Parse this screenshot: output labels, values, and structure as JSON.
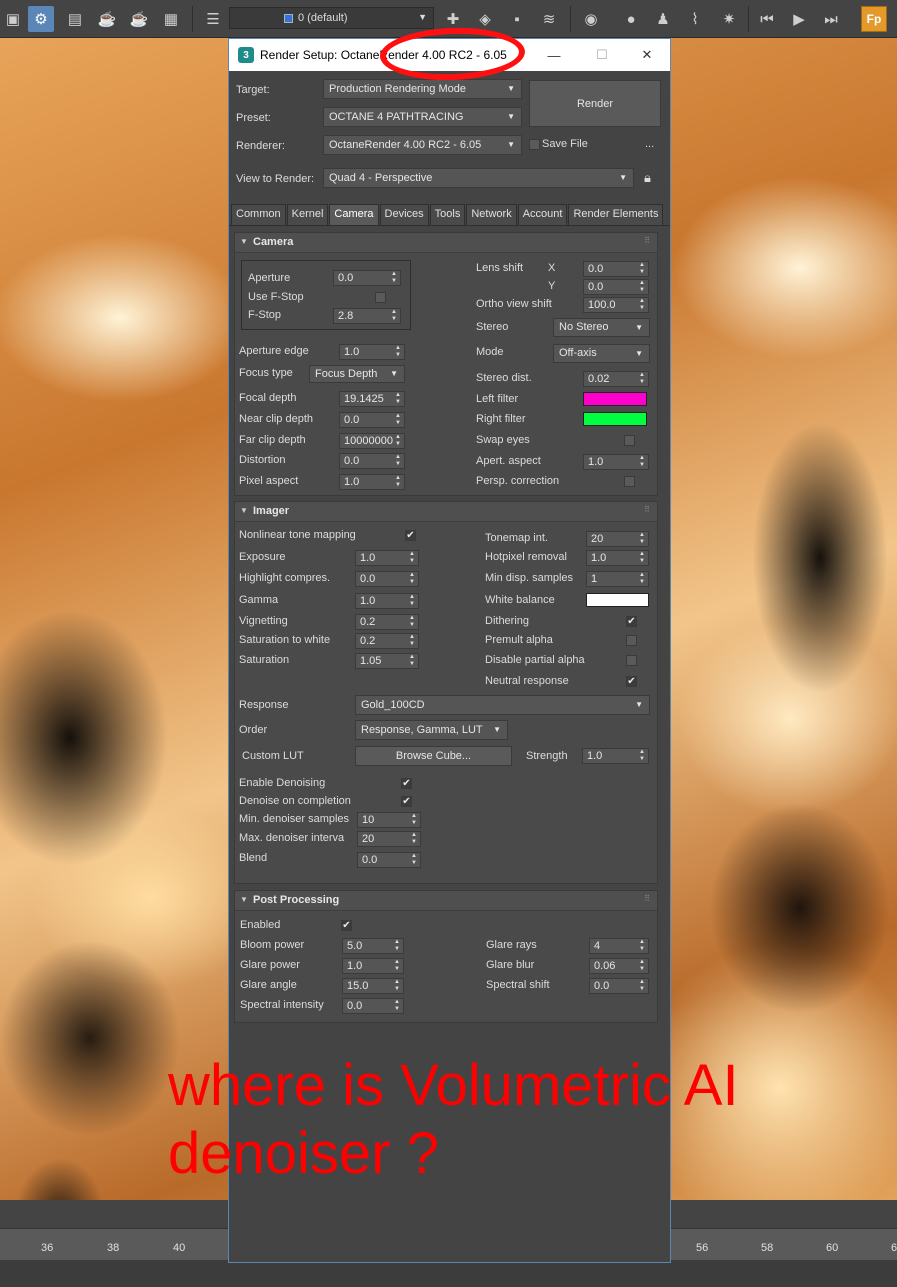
{
  "toolbar": {
    "layer_dropdown": "0 (default)",
    "fp_label": "Fp"
  },
  "dialog": {
    "title": "Render Setup: OctaneRender 4.00 RC2 - 6.05",
    "app_icon": "3",
    "target_label": "Target:",
    "target_value": "Production Rendering Mode",
    "preset_label": "Preset:",
    "preset_value": "OCTANE 4 PATHTRACING",
    "renderer_label": "Renderer:",
    "renderer_value": "OctaneRender 4.00 RC2 - 6.05",
    "render_button": "Render",
    "save_file_label": "Save File",
    "more_label": "...",
    "view_label": "View to Render:",
    "view_value": "Quad 4 - Perspective",
    "tabs": [
      "Common",
      "Kernel",
      "Camera",
      "Devices",
      "Tools",
      "Network",
      "Account",
      "Render Elements"
    ],
    "active_tab": "Camera"
  },
  "camera": {
    "title": "Camera",
    "aperture_label": "Aperture",
    "aperture": "0.0",
    "use_fstop_label": "Use F-Stop",
    "fstop_label": "F-Stop",
    "fstop": "2.8",
    "aperture_edge_label": "Aperture edge",
    "aperture_edge": "1.0",
    "focus_type_label": "Focus type",
    "focus_type": "Focus Depth",
    "focal_depth_label": "Focal depth",
    "focal_depth": "19.1425",
    "near_clip_label": "Near clip depth",
    "near_clip": "0.0",
    "far_clip_label": "Far clip depth",
    "far_clip": "10000000",
    "distortion_label": "Distortion",
    "distortion": "0.0",
    "pixel_aspect_label": "Pixel aspect",
    "pixel_aspect": "1.0",
    "lens_shift_label": "Lens shift",
    "x_label": "X",
    "y_label": "Y",
    "lens_shift_x": "0.0",
    "lens_shift_y": "0.0",
    "ortho_label": "Ortho view shift",
    "ortho": "100.0",
    "stereo_label": "Stereo",
    "stereo": "No Stereo",
    "mode_label": "Mode",
    "mode": "Off-axis",
    "stereo_dist_label": "Stereo dist.",
    "stereo_dist": "0.02",
    "left_filter_label": "Left filter",
    "left_filter_color": "#ff00cc",
    "right_filter_label": "Right filter",
    "right_filter_color": "#00ff40",
    "swap_eyes_label": "Swap eyes",
    "apert_aspect_label": "Apert. aspect",
    "apert_aspect": "1.0",
    "persp_corr_label": "Persp. correction"
  },
  "imager": {
    "title": "Imager",
    "nonlinear_label": "Nonlinear tone mapping",
    "exposure_label": "Exposure",
    "exposure": "1.0",
    "highlight_label": "Highlight compres.",
    "highlight": "0.0",
    "gamma_label": "Gamma",
    "gamma": "1.0",
    "vignetting_label": "Vignetting",
    "vignetting": "0.2",
    "sat_white_label": "Saturation to white",
    "sat_white": "0.2",
    "saturation_label": "Saturation",
    "saturation": "1.05",
    "tonemap_label": "Tonemap int.",
    "tonemap": "20",
    "hotpixel_label": "Hotpixel removal",
    "hotpixel": "1.0",
    "min_disp_label": "Min disp. samples",
    "min_disp": "1",
    "white_balance_label": "White balance",
    "white_balance_color": "#ffffff",
    "dithering_label": "Dithering",
    "premult_label": "Premult alpha",
    "disable_partial_label": "Disable partial alpha",
    "neutral_label": "Neutral response",
    "response_label": "Response",
    "response": "Gold_100CD",
    "order_label": "Order",
    "order": "Response, Gamma, LUT",
    "custom_lut_label": "Custom LUT",
    "browse_cube": "Browse Cube...",
    "strength_label": "Strength",
    "strength": "1.0",
    "enable_denoise_label": "Enable Denoising",
    "denoise_completion_label": "Denoise on completion",
    "min_denoiser_label": "Min. denoiser samples",
    "min_denoiser": "10",
    "max_denoiser_label": "Max. denoiser interva",
    "max_denoiser": "20",
    "blend_label": "Blend",
    "blend": "0.0",
    "check_mark": "✔"
  },
  "post": {
    "title": "Post Processing",
    "enabled_label": "Enabled",
    "bloom_label": "Bloom power",
    "bloom": "5.0",
    "glare_power_label": "Glare power",
    "glare_power": "1.0",
    "glare_angle_label": "Glare angle",
    "glare_angle": "15.0",
    "spectral_int_label": "Spectral intensity",
    "spectral_int": "0.0",
    "glare_rays_label": "Glare rays",
    "glare_rays": "4",
    "glare_blur_label": "Glare blur",
    "glare_blur": "0.06",
    "spectral_shift_label": "Spectral shift",
    "spectral_shift": "0.0"
  },
  "timeline": {
    "ticks": [
      "36",
      "38",
      "40",
      "56",
      "58",
      "60",
      "6"
    ]
  },
  "annotation": {
    "text": "where is Volumetric AI denoiser ?"
  }
}
